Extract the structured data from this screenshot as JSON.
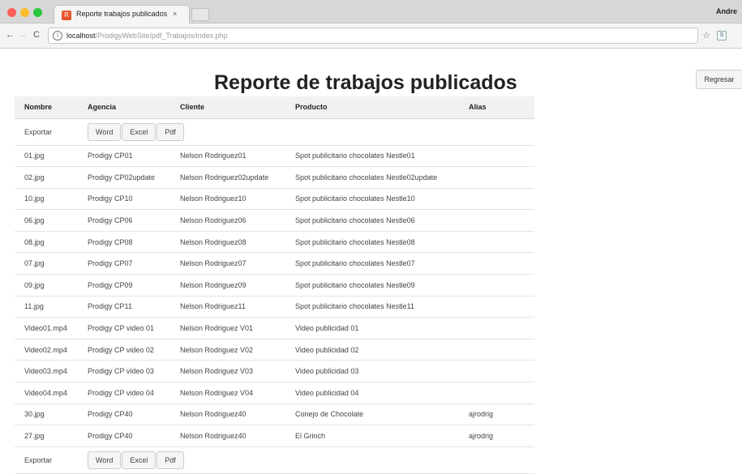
{
  "browser": {
    "tab_title": "Reporte trabajos publicados",
    "tab_close": "×",
    "tab_favicon": "R",
    "user_name": "Andre",
    "url_host": "localhost",
    "url_path": "/ProdigyWebSite/pdf_Trabajos/index.php",
    "nav_back": "←",
    "nav_forward": "→",
    "nav_reload": "C",
    "info_icon": "i",
    "star_icon": "☆",
    "extension_icon": "S"
  },
  "page": {
    "title": "Reporte de trabajos publicados",
    "back_button": "Regresar"
  },
  "table": {
    "headers": [
      "Nombre",
      "Agencia",
      "Cliente",
      "Producto",
      "Alias"
    ],
    "export": {
      "label": "Exportar",
      "buttons": [
        "Word",
        "Excel",
        "Pdf"
      ]
    },
    "rows": [
      [
        "01.jpg",
        "Prodigy CP01",
        "Nelson Rodriguez01",
        "Spot publicitario chocolates Nestle01",
        ""
      ],
      [
        "02.jpg",
        "Prodigy CP02update",
        "Nelson Rodriguez02update",
        "Spot publicitario chocolates Nestle02update",
        ""
      ],
      [
        "10.jpg",
        "Prodigy CP10",
        "Nelson Rodriguez10",
        "Spot publicitario chocolates Nestle10",
        ""
      ],
      [
        "06.jpg",
        "Prodigy CP06",
        "Nelson Rodriguez06",
        "Spot publicitario chocolates Nestle06",
        ""
      ],
      [
        "08.jpg",
        "Prodigy CP08",
        "Nelson Rodriguez08",
        "Spot publicitario chocolates Nestle08",
        ""
      ],
      [
        "07.jpg",
        "Prodigy CP07",
        "Nelson Rodriguez07",
        "Spot publicitario chocolates Nestle07",
        ""
      ],
      [
        "09.jpg",
        "Prodigy CP09",
        "Nelson Rodriguez09",
        "Spot publicitario chocolates Nestle09",
        ""
      ],
      [
        "11.jpg",
        "Prodigy CP11",
        "Nelson Rodriguez11",
        "Spot publicitario chocolates Nestle11",
        ""
      ],
      [
        "Video01.mp4",
        "Prodigy CP video 01",
        "Nelson Rodriguez V01",
        "Video publicidad 01",
        ""
      ],
      [
        "Video02.mp4",
        "Prodigy CP video 02",
        "Nelson Rodriguez V02",
        "Video publicidad 02",
        ""
      ],
      [
        "Video03.mp4",
        "Prodigy CP video 03",
        "Nelson Rodriguez V03",
        "Video publicidad 03",
        ""
      ],
      [
        "Video04.mp4",
        "Prodigy CP video 04",
        "Nelson Rodriguez V04",
        "Video publicidad 04",
        ""
      ],
      [
        "30.jpg",
        "Prodigy CP40",
        "Nelson Rodriguez40",
        "Conejo de Chocolate",
        "ajrodrig"
      ],
      [
        "27.jpg",
        "Prodigy CP40",
        "Nelson Rodriguez40",
        "El Grinch",
        "ajrodrig"
      ]
    ]
  }
}
